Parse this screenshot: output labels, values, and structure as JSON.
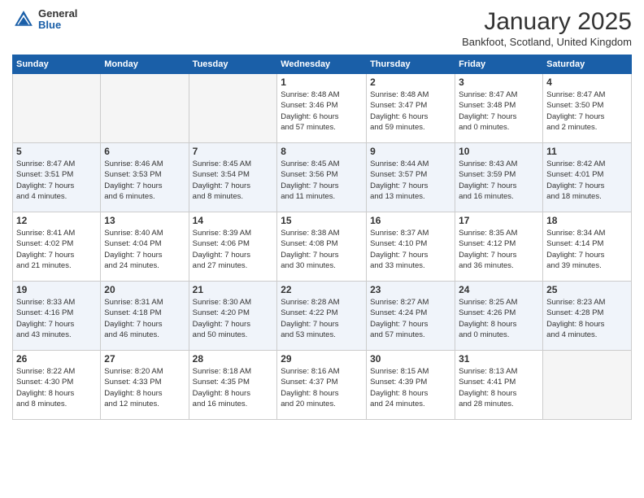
{
  "header": {
    "logo_general": "General",
    "logo_blue": "Blue",
    "month_title": "January 2025",
    "location": "Bankfoot, Scotland, United Kingdom"
  },
  "weekdays": [
    "Sunday",
    "Monday",
    "Tuesday",
    "Wednesday",
    "Thursday",
    "Friday",
    "Saturday"
  ],
  "weeks": [
    [
      {
        "day": "",
        "info": ""
      },
      {
        "day": "",
        "info": ""
      },
      {
        "day": "",
        "info": ""
      },
      {
        "day": "1",
        "info": "Sunrise: 8:48 AM\nSunset: 3:46 PM\nDaylight: 6 hours\nand 57 minutes."
      },
      {
        "day": "2",
        "info": "Sunrise: 8:48 AM\nSunset: 3:47 PM\nDaylight: 6 hours\nand 59 minutes."
      },
      {
        "day": "3",
        "info": "Sunrise: 8:47 AM\nSunset: 3:48 PM\nDaylight: 7 hours\nand 0 minutes."
      },
      {
        "day": "4",
        "info": "Sunrise: 8:47 AM\nSunset: 3:50 PM\nDaylight: 7 hours\nand 2 minutes."
      }
    ],
    [
      {
        "day": "5",
        "info": "Sunrise: 8:47 AM\nSunset: 3:51 PM\nDaylight: 7 hours\nand 4 minutes."
      },
      {
        "day": "6",
        "info": "Sunrise: 8:46 AM\nSunset: 3:53 PM\nDaylight: 7 hours\nand 6 minutes."
      },
      {
        "day": "7",
        "info": "Sunrise: 8:45 AM\nSunset: 3:54 PM\nDaylight: 7 hours\nand 8 minutes."
      },
      {
        "day": "8",
        "info": "Sunrise: 8:45 AM\nSunset: 3:56 PM\nDaylight: 7 hours\nand 11 minutes."
      },
      {
        "day": "9",
        "info": "Sunrise: 8:44 AM\nSunset: 3:57 PM\nDaylight: 7 hours\nand 13 minutes."
      },
      {
        "day": "10",
        "info": "Sunrise: 8:43 AM\nSunset: 3:59 PM\nDaylight: 7 hours\nand 16 minutes."
      },
      {
        "day": "11",
        "info": "Sunrise: 8:42 AM\nSunset: 4:01 PM\nDaylight: 7 hours\nand 18 minutes."
      }
    ],
    [
      {
        "day": "12",
        "info": "Sunrise: 8:41 AM\nSunset: 4:02 PM\nDaylight: 7 hours\nand 21 minutes."
      },
      {
        "day": "13",
        "info": "Sunrise: 8:40 AM\nSunset: 4:04 PM\nDaylight: 7 hours\nand 24 minutes."
      },
      {
        "day": "14",
        "info": "Sunrise: 8:39 AM\nSunset: 4:06 PM\nDaylight: 7 hours\nand 27 minutes."
      },
      {
        "day": "15",
        "info": "Sunrise: 8:38 AM\nSunset: 4:08 PM\nDaylight: 7 hours\nand 30 minutes."
      },
      {
        "day": "16",
        "info": "Sunrise: 8:37 AM\nSunset: 4:10 PM\nDaylight: 7 hours\nand 33 minutes."
      },
      {
        "day": "17",
        "info": "Sunrise: 8:35 AM\nSunset: 4:12 PM\nDaylight: 7 hours\nand 36 minutes."
      },
      {
        "day": "18",
        "info": "Sunrise: 8:34 AM\nSunset: 4:14 PM\nDaylight: 7 hours\nand 39 minutes."
      }
    ],
    [
      {
        "day": "19",
        "info": "Sunrise: 8:33 AM\nSunset: 4:16 PM\nDaylight: 7 hours\nand 43 minutes."
      },
      {
        "day": "20",
        "info": "Sunrise: 8:31 AM\nSunset: 4:18 PM\nDaylight: 7 hours\nand 46 minutes."
      },
      {
        "day": "21",
        "info": "Sunrise: 8:30 AM\nSunset: 4:20 PM\nDaylight: 7 hours\nand 50 minutes."
      },
      {
        "day": "22",
        "info": "Sunrise: 8:28 AM\nSunset: 4:22 PM\nDaylight: 7 hours\nand 53 minutes."
      },
      {
        "day": "23",
        "info": "Sunrise: 8:27 AM\nSunset: 4:24 PM\nDaylight: 7 hours\nand 57 minutes."
      },
      {
        "day": "24",
        "info": "Sunrise: 8:25 AM\nSunset: 4:26 PM\nDaylight: 8 hours\nand 0 minutes."
      },
      {
        "day": "25",
        "info": "Sunrise: 8:23 AM\nSunset: 4:28 PM\nDaylight: 8 hours\nand 4 minutes."
      }
    ],
    [
      {
        "day": "26",
        "info": "Sunrise: 8:22 AM\nSunset: 4:30 PM\nDaylight: 8 hours\nand 8 minutes."
      },
      {
        "day": "27",
        "info": "Sunrise: 8:20 AM\nSunset: 4:33 PM\nDaylight: 8 hours\nand 12 minutes."
      },
      {
        "day": "28",
        "info": "Sunrise: 8:18 AM\nSunset: 4:35 PM\nDaylight: 8 hours\nand 16 minutes."
      },
      {
        "day": "29",
        "info": "Sunrise: 8:16 AM\nSunset: 4:37 PM\nDaylight: 8 hours\nand 20 minutes."
      },
      {
        "day": "30",
        "info": "Sunrise: 8:15 AM\nSunset: 4:39 PM\nDaylight: 8 hours\nand 24 minutes."
      },
      {
        "day": "31",
        "info": "Sunrise: 8:13 AM\nSunset: 4:41 PM\nDaylight: 8 hours\nand 28 minutes."
      },
      {
        "day": "",
        "info": ""
      }
    ]
  ]
}
